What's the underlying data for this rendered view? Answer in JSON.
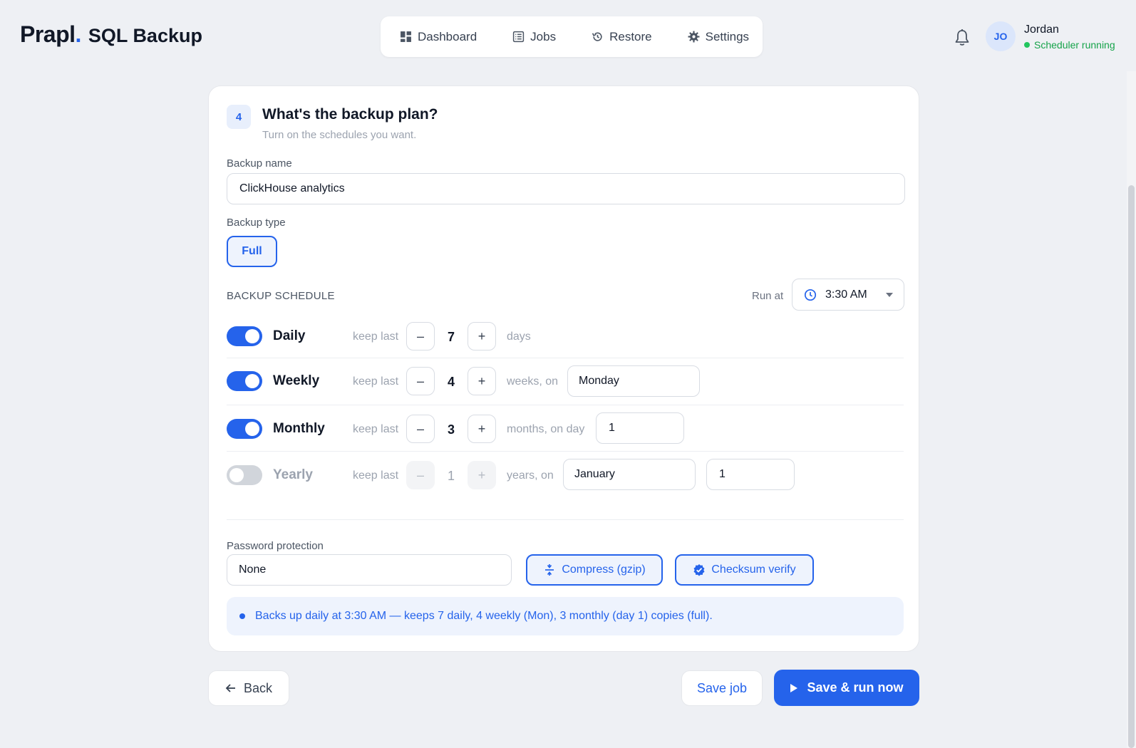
{
  "brand": {
    "name": "Prapl",
    "dot": ".",
    "product": "SQL Backup"
  },
  "nav": [
    {
      "label": "Dashboard",
      "icon": "dashboard-icon"
    },
    {
      "label": "Jobs",
      "icon": "list-icon"
    },
    {
      "label": "Restore",
      "icon": "history-icon"
    },
    {
      "label": "Settings",
      "icon": "gear-icon"
    }
  ],
  "user": {
    "initials": "JO",
    "name": "Jordan",
    "status": "Scheduler running"
  },
  "step": {
    "number": "4",
    "title": "What's the backup plan?",
    "subtitle": "Turn on the schedules you want."
  },
  "form": {
    "name_label": "Backup name",
    "name_value": "ClickHouse analytics",
    "type_label": "Backup type",
    "type_value": "Full",
    "schedule_heading": "BACKUP SCHEDULE",
    "run_at_label": "Run at",
    "run_at_value": "3:30 AM",
    "keep_label": "keep last",
    "minus": "–",
    "plus": "+"
  },
  "schedules": [
    {
      "name": "Daily",
      "enabled": true,
      "count": "7",
      "unit": "days"
    },
    {
      "name": "Weekly",
      "enabled": true,
      "count": "4",
      "unit": "weeks, on",
      "day": "Monday"
    },
    {
      "name": "Monthly",
      "enabled": true,
      "count": "3",
      "unit": "months, on day",
      "day": "1"
    },
    {
      "name": "Yearly",
      "enabled": false,
      "count": "1",
      "unit": "years, on",
      "month": "January",
      "day": "1"
    }
  ],
  "password": {
    "label": "Password protection",
    "value": "None"
  },
  "options": {
    "compress": "Compress (gzip)",
    "checksum": "Checksum verify"
  },
  "summary": "Backs up daily at 3:30 AM — keeps 7 daily, 4 weekly (Mon), 3 monthly (day 1) copies (full).",
  "actions": {
    "back": "Back",
    "save": "Save job",
    "run": "Save & run now"
  },
  "colors": {
    "accent": "#2563eb",
    "success": "#22c55e",
    "background": "#eef0f4"
  }
}
